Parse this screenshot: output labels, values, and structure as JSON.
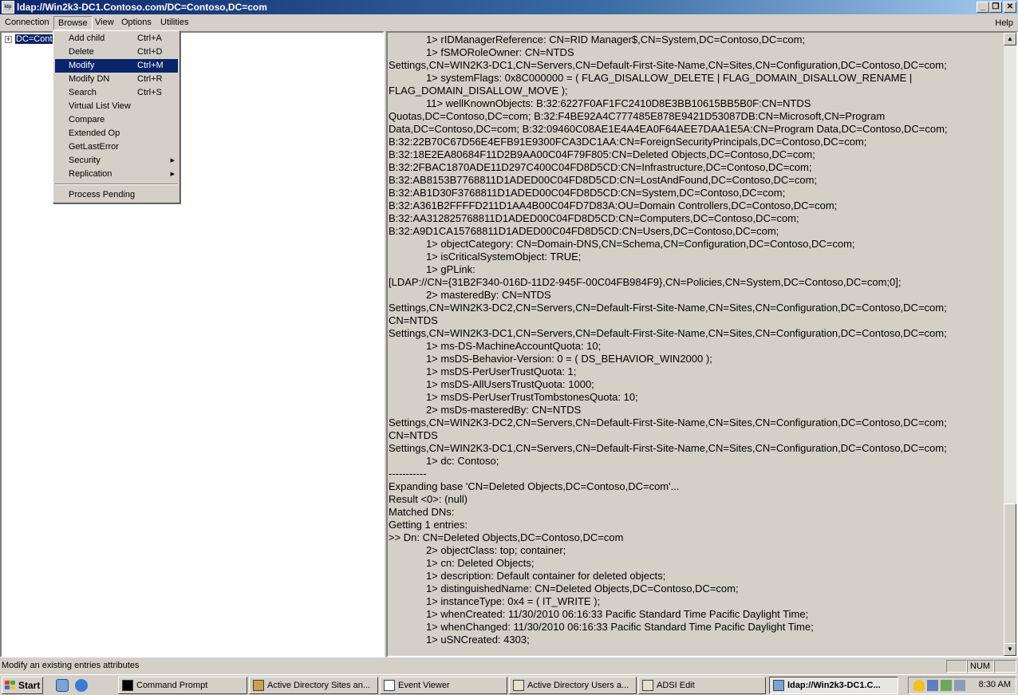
{
  "window": {
    "title": "ldap://Win2k3-DC1.Contoso.com/DC=Contoso,DC=com",
    "app_icon_label": "ldp",
    "min_glyph": "_",
    "max_glyph": "❐",
    "close_glyph": "✕"
  },
  "menubar": {
    "items": [
      "Connection",
      "Browse",
      "View",
      "Options",
      "Utilities"
    ],
    "help": "Help"
  },
  "tree": {
    "expander": "+",
    "root_label": "DC=Cont"
  },
  "browse_menu": {
    "items": [
      {
        "label": "Add child",
        "shortcut": "Ctrl+A"
      },
      {
        "label": "Delete",
        "shortcut": "Ctrl+D"
      },
      {
        "label": "Modify",
        "shortcut": "Ctrl+M"
      },
      {
        "label": "Modify DN",
        "shortcut": "Ctrl+R"
      },
      {
        "label": "Search",
        "shortcut": "Ctrl+S"
      },
      {
        "label": "Virtual List View",
        "shortcut": ""
      },
      {
        "label": "Compare",
        "shortcut": ""
      },
      {
        "label": "Extended Op",
        "shortcut": ""
      },
      {
        "label": "GetLastError",
        "shortcut": ""
      },
      {
        "label": "Security",
        "shortcut": ""
      },
      {
        "label": "Replication",
        "shortcut": ""
      },
      {
        "label": "Process Pending",
        "shortcut": ""
      }
    ],
    "selected": "Modify"
  },
  "output": {
    "lines": [
      "             1> rIDManagerReference: CN=RID Manager$,CN=System,DC=Contoso,DC=com;",
      "             1> fSMORoleOwner: CN=NTDS",
      "Settings,CN=WIN2K3-DC1,CN=Servers,CN=Default-First-Site-Name,CN=Sites,CN=Configuration,DC=Contoso,DC=com;",
      "             1> systemFlags: 0x8C000000 = ( FLAG_DISALLOW_DELETE | FLAG_DOMAIN_DISALLOW_RENAME |",
      "FLAG_DOMAIN_DISALLOW_MOVE );",
      "             11> wellKnownObjects: B:32:6227F0AF1FC2410D8E3BB10615BB5B0F:CN=NTDS",
      "Quotas,DC=Contoso,DC=com; B:32:F4BE92A4C777485E878E9421D53087DB:CN=Microsoft,CN=Program",
      "Data,DC=Contoso,DC=com; B:32:09460C08AE1E4A4EA0F64AEE7DAA1E5A:CN=Program Data,DC=Contoso,DC=com;",
      "B:32:22B70C67D56E4EFB91E9300FCA3DC1AA:CN=ForeignSecurityPrincipals,DC=Contoso,DC=com;",
      "B:32:18E2EA80684F11D2B9AA00C04F79F805:CN=Deleted Objects,DC=Contoso,DC=com;",
      "B:32:2FBAC1870ADE11D297C400C04FD8D5CD:CN=Infrastructure,DC=Contoso,DC=com;",
      "B:32:AB8153B7768811D1ADED00C04FD8D5CD:CN=LostAndFound,DC=Contoso,DC=com;",
      "B:32:AB1D30F3768811D1ADED00C04FD8D5CD:CN=System,DC=Contoso,DC=com;",
      "B:32:A361B2FFFFD211D1AA4B00C04FD7D83A:OU=Domain Controllers,DC=Contoso,DC=com;",
      "B:32:AA312825768811D1ADED00C04FD8D5CD:CN=Computers,DC=Contoso,DC=com;",
      "B:32:A9D1CA15768811D1ADED00C04FD8D5CD:CN=Users,DC=Contoso,DC=com;",
      "             1> objectCategory: CN=Domain-DNS,CN=Schema,CN=Configuration,DC=Contoso,DC=com;",
      "             1> isCriticalSystemObject: TRUE;",
      "             1> gPLink:",
      "[LDAP://CN={31B2F340-016D-11D2-945F-00C04FB984F9},CN=Policies,CN=System,DC=Contoso,DC=com;0];",
      "             2> masteredBy: CN=NTDS",
      "Settings,CN=WIN2K3-DC2,CN=Servers,CN=Default-First-Site-Name,CN=Sites,CN=Configuration,DC=Contoso,DC=com;",
      "CN=NTDS",
      "Settings,CN=WIN2K3-DC1,CN=Servers,CN=Default-First-Site-Name,CN=Sites,CN=Configuration,DC=Contoso,DC=com;",
      "             1> ms-DS-MachineAccountQuota: 10;",
      "             1> msDS-Behavior-Version: 0 = ( DS_BEHAVIOR_WIN2000 );",
      "             1> msDS-PerUserTrustQuota: 1;",
      "             1> msDS-AllUsersTrustQuota: 1000;",
      "             1> msDS-PerUserTrustTombstonesQuota: 10;",
      "             2> msDs-masteredBy: CN=NTDS",
      "Settings,CN=WIN2K3-DC2,CN=Servers,CN=Default-First-Site-Name,CN=Sites,CN=Configuration,DC=Contoso,DC=com;",
      "CN=NTDS",
      "Settings,CN=WIN2K3-DC1,CN=Servers,CN=Default-First-Site-Name,CN=Sites,CN=Configuration,DC=Contoso,DC=com;",
      "             1> dc: Contoso;",
      "-----------",
      "Expanding base 'CN=Deleted Objects,DC=Contoso,DC=com'...",
      "Result <0>: (null)",
      "Matched DNs:",
      "Getting 1 entries:",
      ">> Dn: CN=Deleted Objects,DC=Contoso,DC=com",
      "             2> objectClass: top; container;",
      "             1> cn: Deleted Objects;",
      "             1> description: Default container for deleted objects;",
      "             1> distinguishedName: CN=Deleted Objects,DC=Contoso,DC=com;",
      "             1> instanceType: 0x4 = ( IT_WRITE );",
      "             1> whenCreated: 11/30/2010 06:16:33 Pacific Standard Time Pacific Daylight Time;",
      "             1> whenChanged: 11/30/2010 06:16:33 Pacific Standard Time Pacific Daylight Time;",
      "             1> uSNCreated: 4303;"
    ]
  },
  "statusbar": {
    "text": "Modify an existing entries attributes",
    "num": "NUM"
  },
  "taskbar": {
    "start": "Start",
    "tasks": [
      "Command Prompt",
      "Active Directory Sites an...",
      "Event Viewer",
      "Active Directory Users a...",
      "ADSI Edit",
      "ldap://Win2k3-DC1.C..."
    ],
    "clock": "8:30 AM"
  },
  "colors": {
    "selection": "#0a246a",
    "face": "#d4d0c8"
  }
}
